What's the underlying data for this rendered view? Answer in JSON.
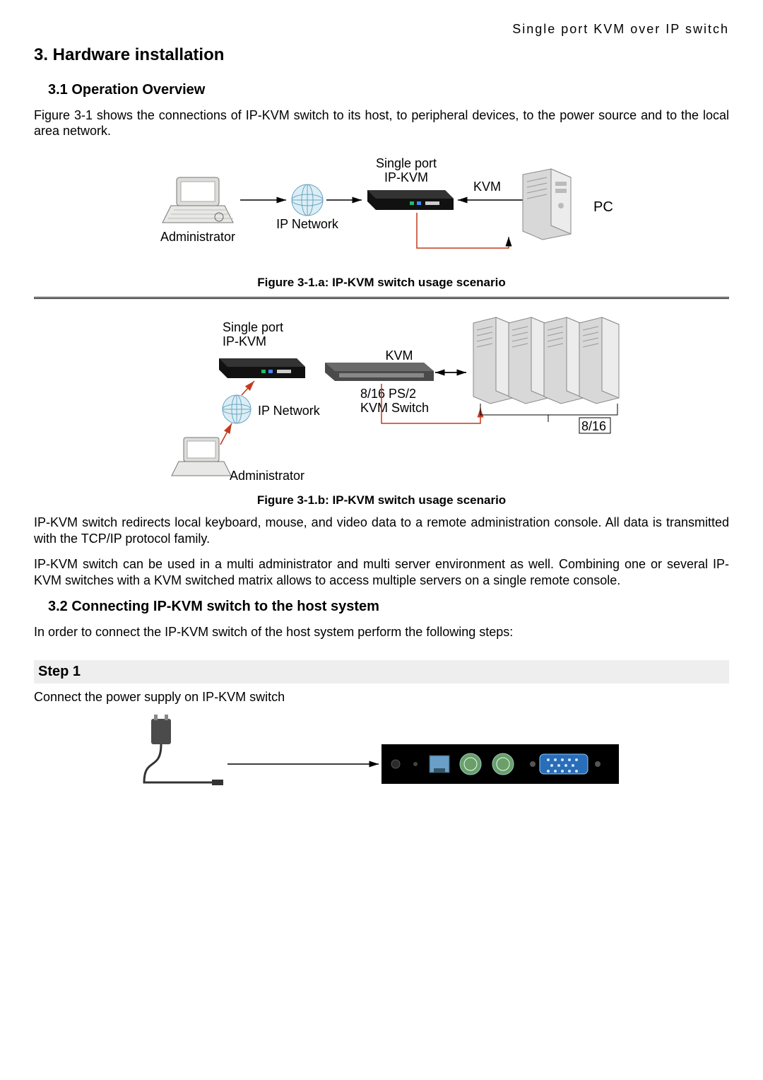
{
  "header": {
    "running": "Single  port  KVM  over  IP  switch"
  },
  "h1": "3.  Hardware installation",
  "sec31": {
    "title": "3.1 Operation Overview",
    "intro": "Figure 3-1 shows the connections of IP-KVM switch to its host, to peripheral devices, to the power source and to the local area network.",
    "figA": {
      "caption": "Figure 3-1.a: IP-KVM switch usage scenario",
      "labels": {
        "admin": "Administrator",
        "ipnet": "IP Network",
        "sp1": "Single port",
        "sp2": "IP-KVM",
        "kvm": "KVM",
        "pc": "PC"
      }
    },
    "figB": {
      "caption": "Figure 3-1.b: IP-KVM switch usage scenario",
      "labels": {
        "admin": "Administrator",
        "ipnet": "IP Network",
        "sp1": "Single port",
        "sp2": "IP-KVM",
        "kvm": "KVM",
        "sw1": "8/16 PS/2",
        "sw2": "KVM Switch",
        "servers": "8/16"
      }
    },
    "para2": "IP-KVM switch redirects local keyboard, mouse, and video data to a remote administration console. All data is transmitted with the TCP/IP protocol family.",
    "para3": "IP-KVM switch can be used in a multi administrator and multi server environment as well. Combining one or several IP-KVM switches with a KVM switched matrix allows to access multiple servers on a single remote console."
  },
  "sec32": {
    "title": "3.2 Connecting IP-KVM switch to the host system",
    "intro": "In order to connect the IP-KVM switch of the host system perform the following steps:",
    "step1": {
      "title": "Step 1",
      "text": "Connect the power supply on IP-KVM switch"
    }
  }
}
